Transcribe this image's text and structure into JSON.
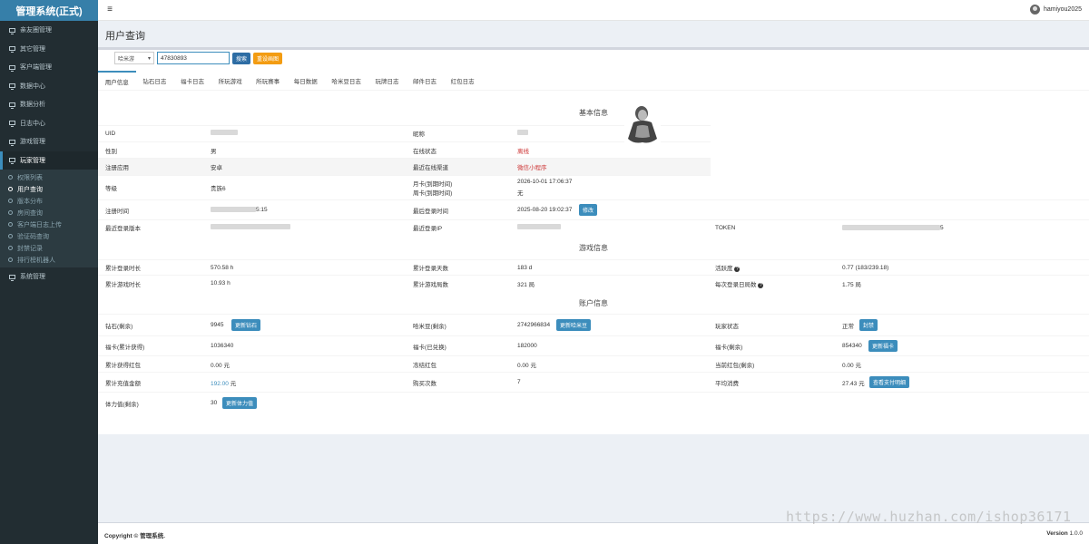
{
  "app_title": "管理系统(正式)",
  "header": {
    "username": "hamiyou2025"
  },
  "sidebar": {
    "items": [
      {
        "label": "亲友圈管理"
      },
      {
        "label": "其它管理"
      },
      {
        "label": "客户端管理"
      },
      {
        "label": "数据中心"
      },
      {
        "label": "数据分析"
      },
      {
        "label": "日志中心"
      },
      {
        "label": "游戏管理"
      },
      {
        "label": "玩家管理"
      }
    ],
    "sub_items": [
      {
        "label": "权限列表"
      },
      {
        "label": "用户查询"
      },
      {
        "label": "版本分布"
      },
      {
        "label": "房间查询"
      },
      {
        "label": "客户端日志上传"
      },
      {
        "label": "验证码查询"
      },
      {
        "label": "封禁记录"
      },
      {
        "label": "排行榜机器人"
      }
    ],
    "last_item": {
      "label": "系统管理"
    }
  },
  "page": {
    "title": "用户查询"
  },
  "search": {
    "select_value": "哈米游",
    "input_value": "47830893",
    "search_button": "搜索",
    "reset_button": "重设画图"
  },
  "tabs": [
    {
      "label": "用户信息"
    },
    {
      "label": "钻石日志"
    },
    {
      "label": "福卡日志"
    },
    {
      "label": "所玩游戏"
    },
    {
      "label": "所玩赛事"
    },
    {
      "label": "每日数据"
    },
    {
      "label": "哈米豆日志"
    },
    {
      "label": "玩牌日志"
    },
    {
      "label": "邮件日志"
    },
    {
      "label": "红包日志"
    }
  ],
  "basic": {
    "title": "基本信息",
    "uid_label": "UID",
    "nickname_label": "昵称",
    "gender_label": "性别",
    "gender_value": "男",
    "online_label": "在线状态",
    "online_value": "离线",
    "reg_app_label": "注册应用",
    "reg_app_value": "安卓",
    "channel_label": "最近在线渠道",
    "channel_value": "微信小程序",
    "level_label": "等级",
    "level_value": "贵族6",
    "monthcard_label": "月卡(到期时间)",
    "monthcard_value": "2026-10-01 17:06:37",
    "weekcard_label": "周卡(到期时间)",
    "weekcard_value": "无",
    "regtime_label": "注册时间",
    "regtime_value": "5:15",
    "lastlogin_label": "最后登录时间",
    "lastlogin_value": "2025-08-20 19:02:37",
    "modify_button": "修改",
    "version_label": "最近登录版本",
    "ip_label": "最近登录IP",
    "token_label": "TOKEN",
    "token_value": "5"
  },
  "game": {
    "title": "游戏信息",
    "login_dur_label": "累计登录时长",
    "login_dur_value": "570.58 h",
    "login_days_label": "累计登录天数",
    "login_days_value": "183 d",
    "activity_label": "活跃度",
    "activity_value": "0.77 (183/239.18)",
    "play_dur_label": "累计游戏时长",
    "play_dur_value": "10.93 h",
    "play_rounds_label": "累计游戏局数",
    "play_rounds_value": "321 局",
    "daily_rounds_label": "每次登录日局数",
    "daily_rounds_value": "1.75 局"
  },
  "account": {
    "title": "账户信息",
    "diamond_label": "钻石(剩余)",
    "diamond_value": "9945",
    "diamond_button": "更新钻石",
    "bean_label": "哈米豆(剩余)",
    "bean_value": "2742966834",
    "bean_button": "更新哈米豆",
    "status_label": "玩家状态",
    "status_value": "正常",
    "ban_button": "封禁",
    "card_total_label": "福卡(累计获得)",
    "card_total_value": "1036340",
    "card_used_label": "福卡(已兑换)",
    "card_used_value": "182000",
    "card_left_label": "福卡(剩余)",
    "card_left_value": "854340",
    "card_button": "更新福卡",
    "redpack_total_label": "累计获得红包",
    "redpack_total_value": "0.00 元",
    "redpack_frozen_label": "冻结红包",
    "redpack_frozen_value": "0.00 元",
    "redpack_left_label": "当前红包(剩余)",
    "redpack_left_value": "0.00 元",
    "recharge_label": "累计充值金额",
    "recharge_amount": "192.00",
    "recharge_unit": "元",
    "buy_count_label": "购买次数",
    "buy_count_value": "7",
    "avg_label": "平均消费",
    "avg_value": "27.43 元",
    "pay_button": "查看支付明细",
    "stamina_label": "体力值(剩余)",
    "stamina_value": "30",
    "stamina_button": "更新体力值"
  },
  "footer": {
    "copyright_prefix": "Copyright ©",
    "copyright_name": "管理系统.",
    "version_label": "Version",
    "version_value": "1.0.0"
  },
  "watermark": "https://www.huzhan.com/ishop36171"
}
